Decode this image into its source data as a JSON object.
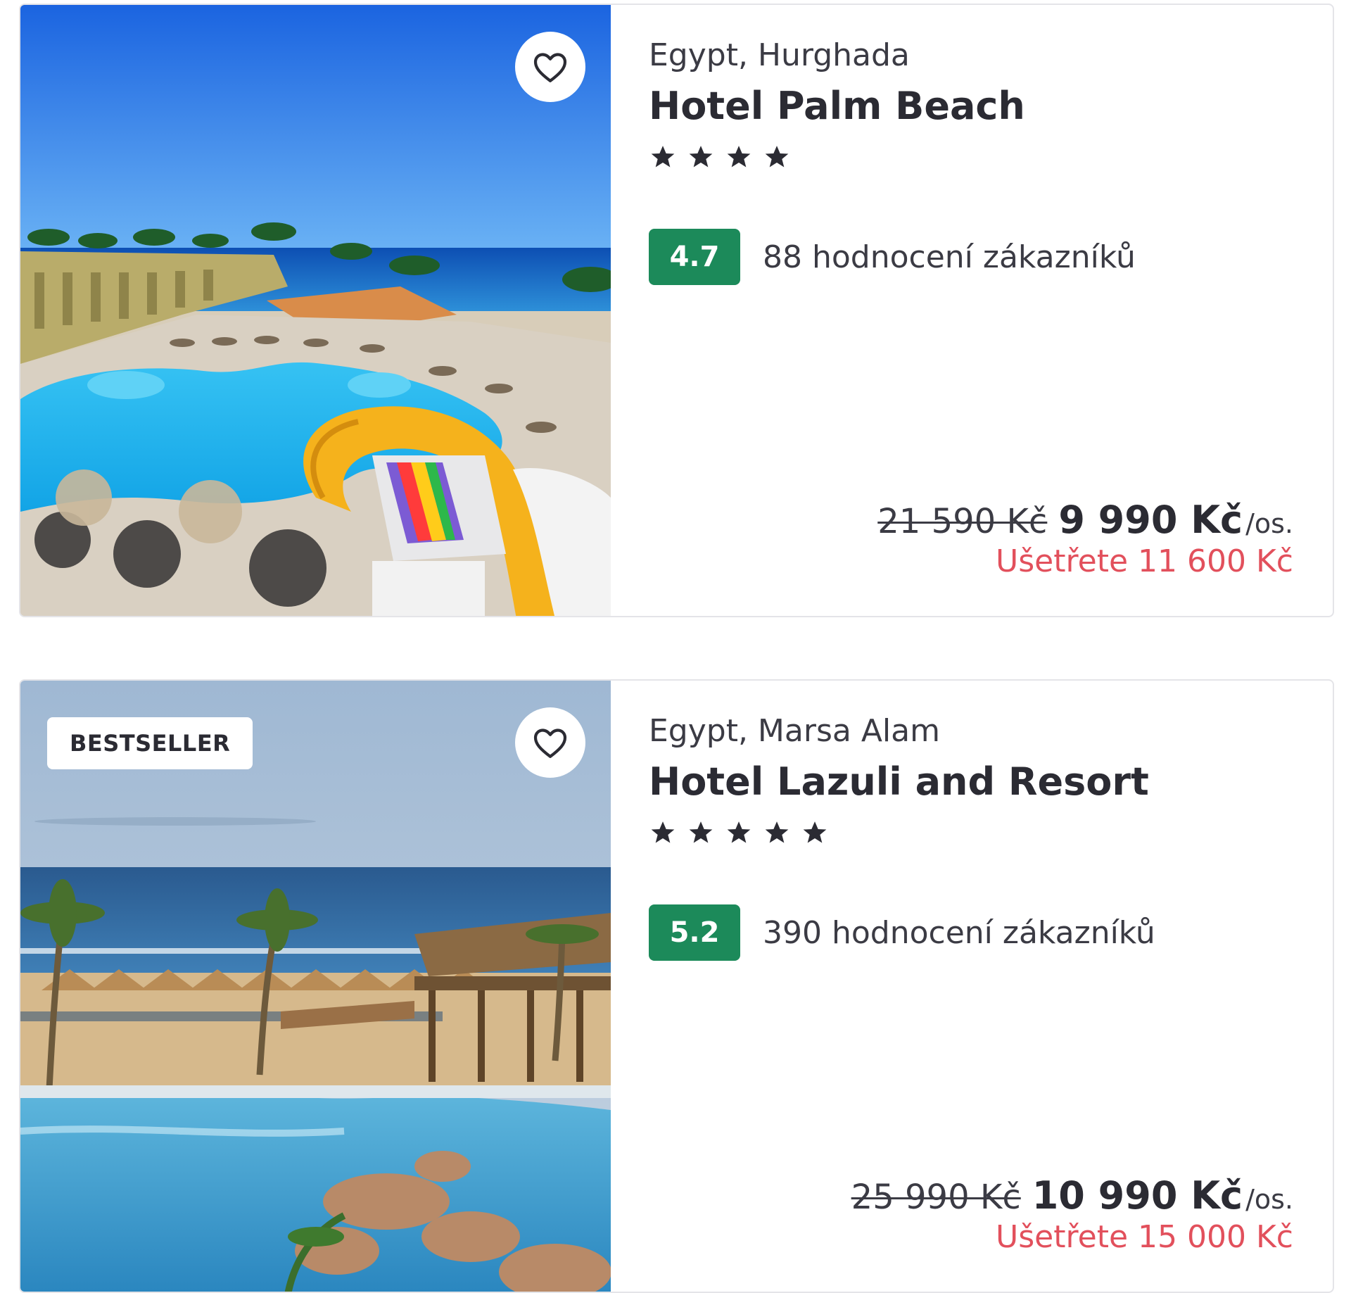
{
  "hotels": [
    {
      "badge": "",
      "location": "Egypt, Hurghada",
      "name": "Hotel Palm Beach",
      "stars": 4,
      "rating": "4.7",
      "reviews": "88 hodnocení zákazníků",
      "old_price": "21 590 Kč",
      "price": "9 990 Kč",
      "per_person": "/os.",
      "savings": "Ušetřete 11 600 Kč",
      "photo": "resort-pool-waterslide-photo"
    },
    {
      "badge": "BESTSELLER",
      "location": "Egypt, Marsa Alam",
      "name": "Hotel Lazuli and Resort",
      "stars": 5,
      "rating": "5.2",
      "reviews": "390 hodnocení zákazníků",
      "old_price": "25 990 Kč",
      "price": "10 990 Kč",
      "per_person": "/os.",
      "savings": "Ušetřete 15 000 Kč",
      "photo": "beach-pool-sunshades-photo"
    }
  ],
  "icons": {
    "favorite": "heart-outline-icon",
    "star": "star-icon"
  },
  "colors": {
    "rating_bg": "#1c8a5a",
    "savings_text": "#e2505c",
    "text_dark": "#2b2b33"
  }
}
